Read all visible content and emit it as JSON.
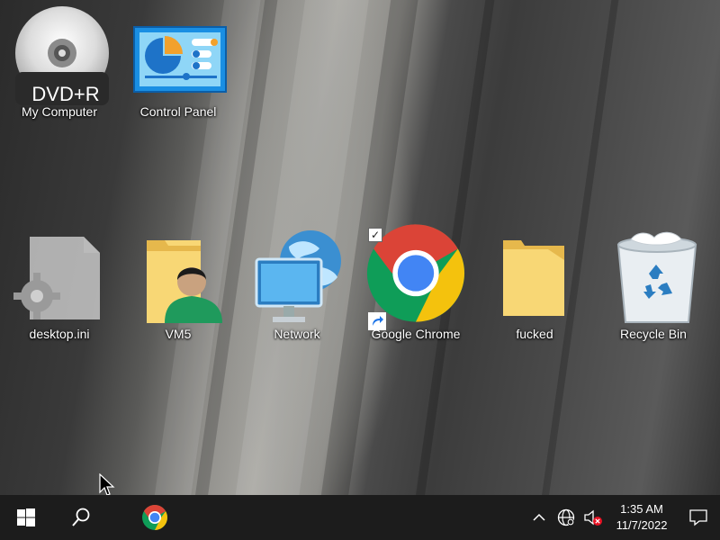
{
  "desktop": {
    "icons": [
      {
        "label": "My Computer",
        "icon": "dvd-drive-icon",
        "badge": "DVD+R"
      },
      {
        "label": "Control Panel",
        "icon": "control-panel-icon"
      },
      {
        "label": "desktop.ini",
        "icon": "settings-file-icon"
      },
      {
        "label": "VM5",
        "icon": "user-folder-icon"
      },
      {
        "label": "Network",
        "icon": "network-icon"
      },
      {
        "label": "Google Chrome",
        "icon": "chrome-shortcut-icon",
        "selected": true
      },
      {
        "label": "fucked",
        "icon": "folder-icon"
      },
      {
        "label": "Recycle Bin",
        "icon": "recycle-bin-icon"
      }
    ]
  },
  "taskbar": {
    "start": "windows-start-icon",
    "search": "search-icon",
    "pinned": [
      "chrome-icon"
    ],
    "tray": {
      "chevron": "chevron-up-icon",
      "network": "globe-network-icon",
      "volume": "volume-muted-icon",
      "time": "1:35 AM",
      "date": "11/7/2022",
      "notifications": "notification-icon"
    }
  },
  "colors": {
    "taskbar": "#1c1c1c",
    "chrome_red": "#db4437",
    "chrome_yellow": "#f4c20d",
    "chrome_green": "#0f9d58",
    "chrome_blue": "#4285f4",
    "folder_yellow": "#f8d775"
  }
}
